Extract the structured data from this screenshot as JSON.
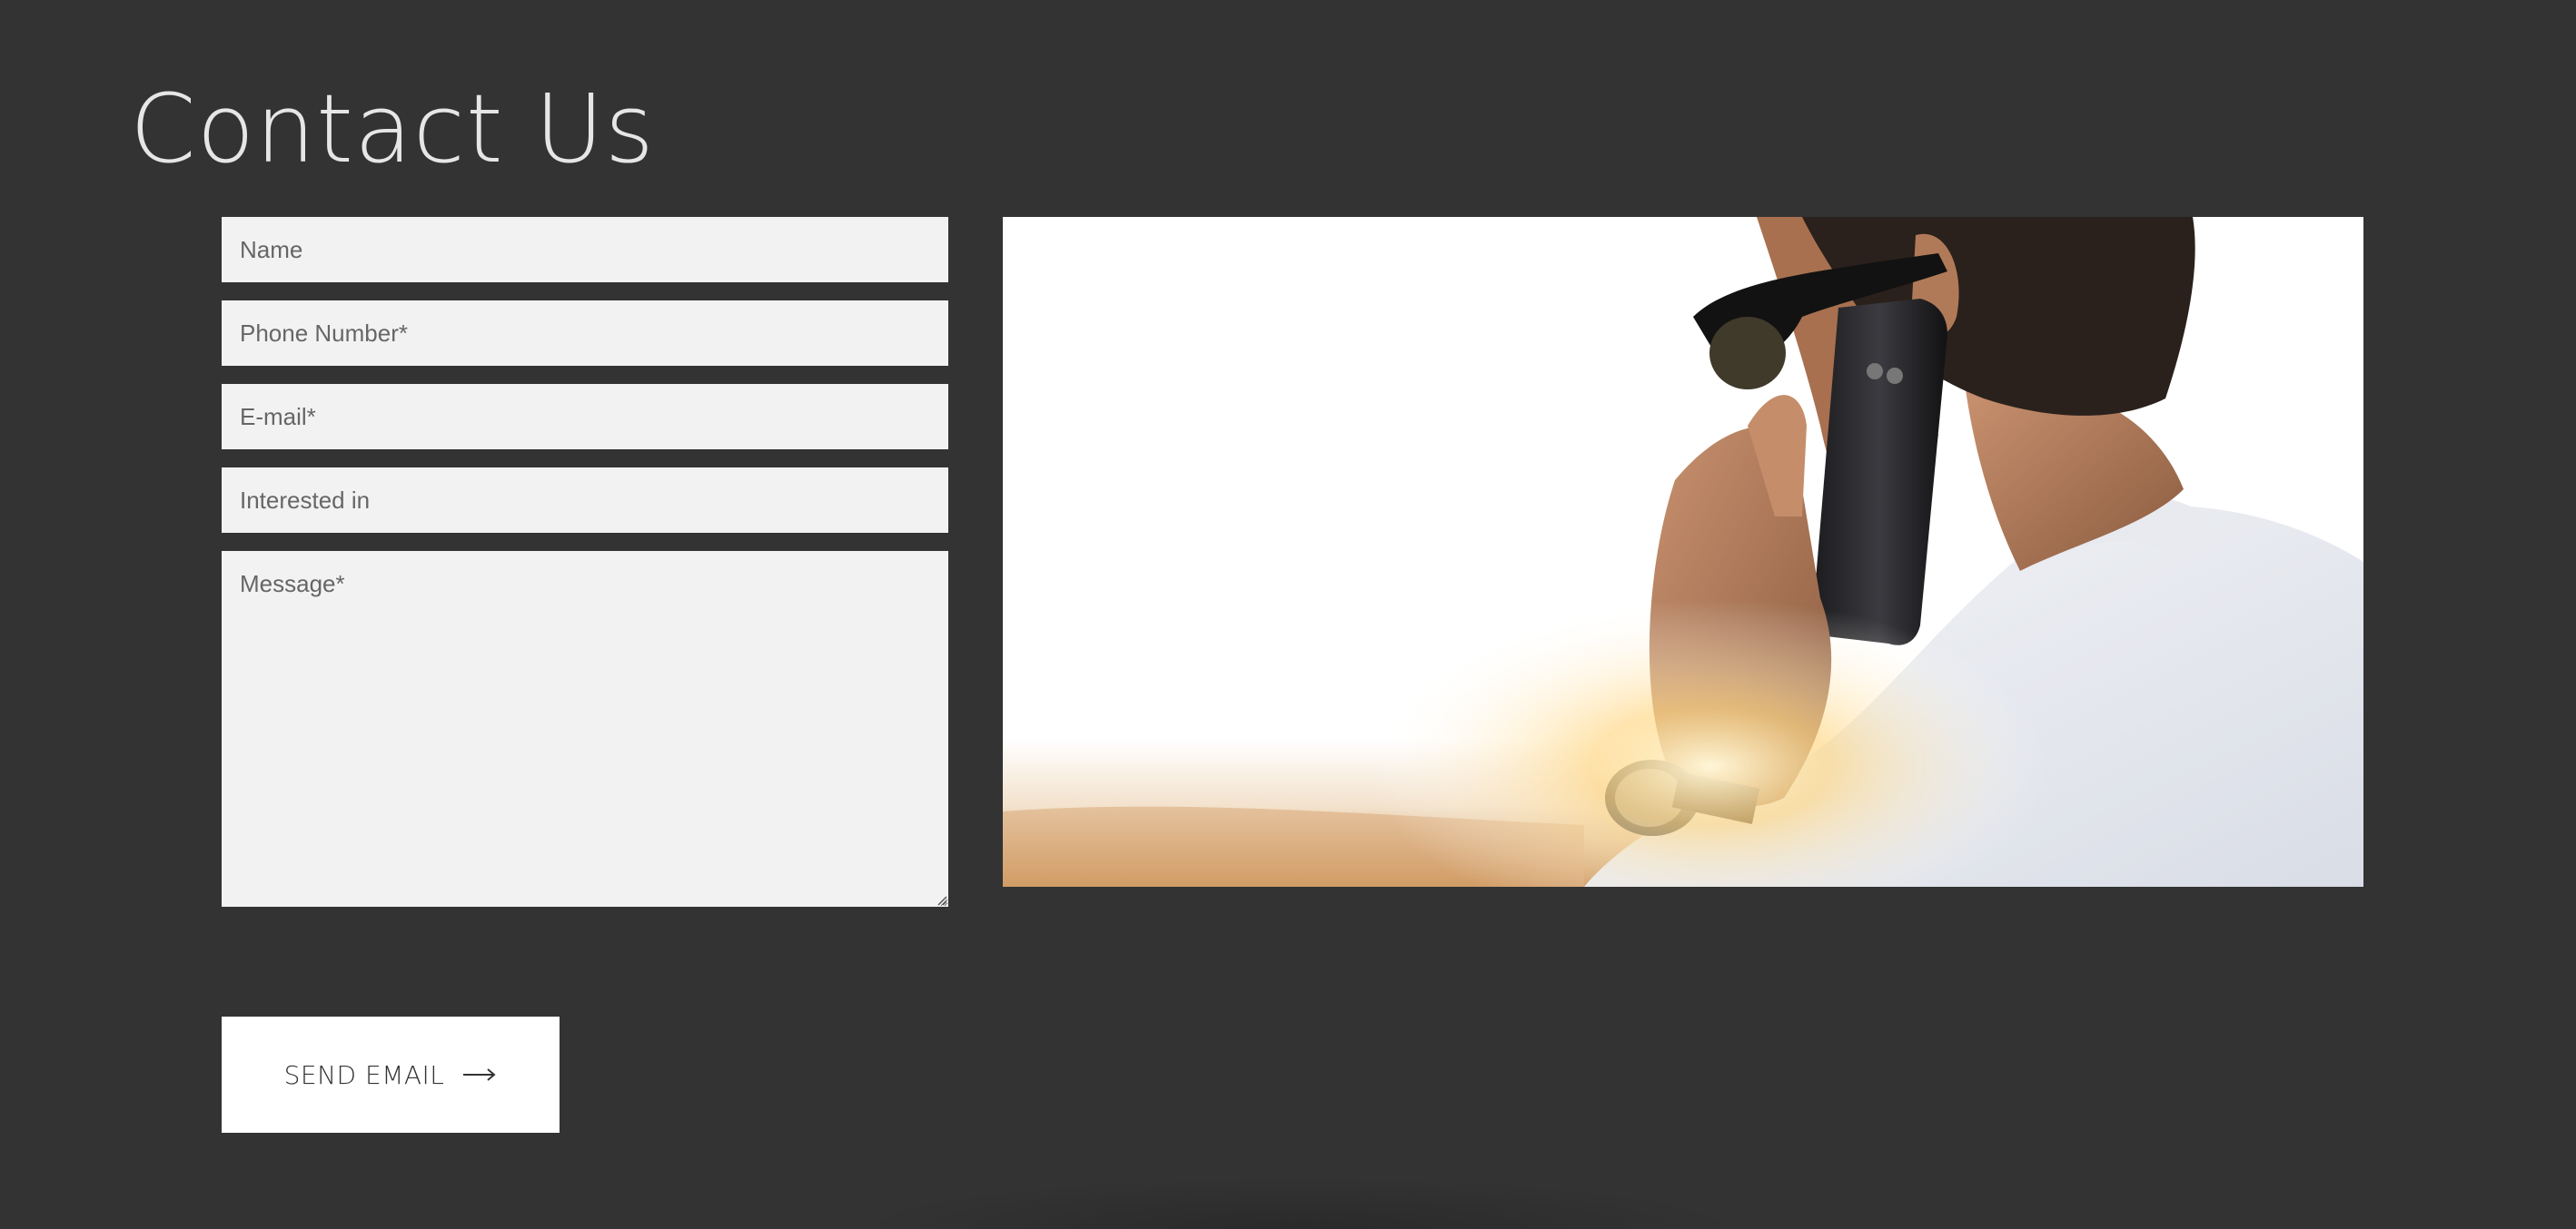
{
  "page": {
    "title": "Contact Us"
  },
  "form": {
    "name_placeholder": "Name",
    "name_value": "",
    "phone_placeholder": "Phone Number*",
    "phone_value": "",
    "email_placeholder": "E-mail*",
    "email_value": "",
    "interest_placeholder": "Interested in",
    "interest_value": "",
    "message_placeholder": "Message*",
    "message_value": "",
    "submit_label": "SEND EMAIL",
    "submit_icon": "arrow-right-icon"
  },
  "image": {
    "subject": "man-on-phone-photo"
  },
  "colors": {
    "background": "#333333",
    "field_background": "#f2f2f2",
    "title": "#e6e6e6",
    "button_background": "#ffffff",
    "button_text": "#333333"
  }
}
